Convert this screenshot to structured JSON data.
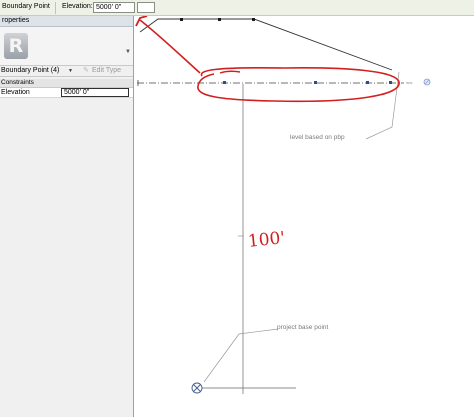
{
  "options_bar": {
    "selection_label": "Boundary Point",
    "elevation_label": "Elevation:",
    "elevation_value": "5000'  0\""
  },
  "properties": {
    "title": "roperties",
    "type_icon_letter": "R",
    "selector_label": "Boundary Point (4)",
    "edit_type_label": "Edit Type",
    "group_label": "Constraints",
    "rows": [
      {
        "name": "Elevation",
        "value": "5000'  0\""
      }
    ]
  },
  "canvas": {
    "level_note": "level based on pbp",
    "project_base_point_note": "project base point",
    "handwritten_dimension": "100'"
  },
  "colors": {
    "options_bar_bg": "#eef2e6",
    "markup_red": "#d21f1f",
    "annotation_gray": "#7b7b7b"
  }
}
